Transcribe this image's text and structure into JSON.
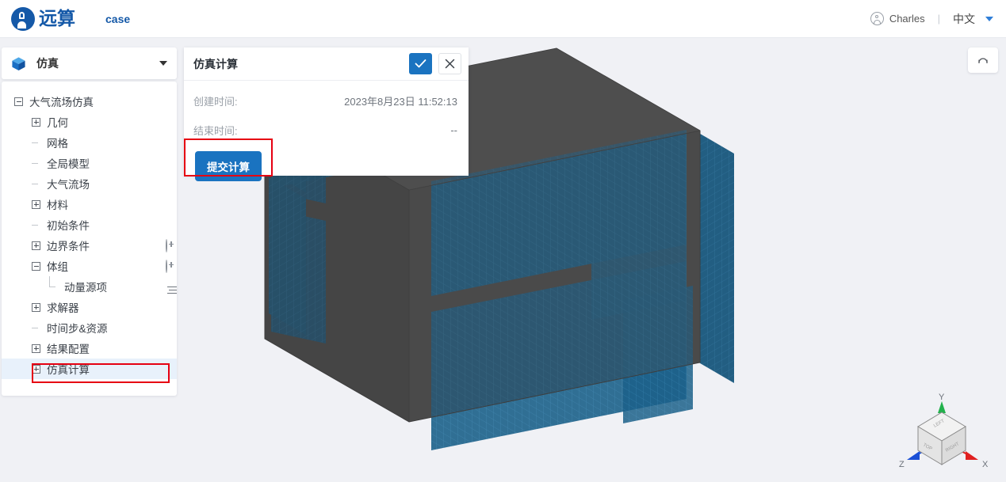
{
  "header": {
    "brand_name": "远算",
    "brand_logo_icon": "yuansuan-logo-icon",
    "case_label": "case",
    "user_name": "Charles",
    "user_icon": "user-avatar-icon",
    "divider": "|",
    "language": "中文",
    "language_caret_icon": "chevron-down-icon"
  },
  "sidebar": {
    "header": {
      "icon": "blue-cube-icon",
      "title": "仿真",
      "caret_icon": "chevron-down-icon"
    },
    "tree": [
      {
        "label": "大气流场仿真",
        "indent": 0,
        "toggle": "minus",
        "action": "warning-icon",
        "selected": false
      },
      {
        "label": "几何",
        "indent": 1,
        "toggle": "plus",
        "action": "",
        "selected": false
      },
      {
        "label": "网格",
        "indent": 1,
        "toggle": "guide",
        "action": "",
        "selected": false
      },
      {
        "label": "全局模型",
        "indent": 1,
        "toggle": "guide",
        "action": "",
        "selected": false
      },
      {
        "label": "大气流场",
        "indent": 1,
        "toggle": "guide",
        "action": "",
        "selected": false
      },
      {
        "label": "材料",
        "indent": 1,
        "toggle": "plus",
        "action": "",
        "selected": false
      },
      {
        "label": "初始条件",
        "indent": 1,
        "toggle": "guide",
        "action": "",
        "selected": false
      },
      {
        "label": "边界条件",
        "indent": 1,
        "toggle": "plus",
        "action": "plus-circle",
        "selected": false
      },
      {
        "label": "体组",
        "indent": 1,
        "toggle": "minus",
        "action": "plus-circle",
        "selected": false
      },
      {
        "label": "动量源项",
        "sub_num": "1",
        "indent": 2,
        "toggle": "elbow",
        "action": "menu-icon",
        "selected": false
      },
      {
        "label": "求解器",
        "indent": 1,
        "toggle": "plus",
        "action": "",
        "selected": false
      },
      {
        "label": "时间步&资源",
        "indent": 1,
        "toggle": "guide",
        "action": "",
        "selected": false
      },
      {
        "label": "结果配置",
        "indent": 1,
        "toggle": "plus",
        "action": "",
        "selected": false
      },
      {
        "label": "仿真计算",
        "indent": 1,
        "toggle": "plus",
        "action": "",
        "selected": true
      }
    ]
  },
  "detail_panel": {
    "title": "仿真计算",
    "confirm_icon": "check-icon",
    "cancel_icon": "close-icon",
    "rows": [
      {
        "key": "创建时间:",
        "value": "2023年8月23日 11:52:13"
      },
      {
        "key": "结束时间:",
        "value": "--"
      }
    ],
    "submit_label": "提交计算"
  },
  "viewport": {
    "reset_view_icon": "reset-view-icon",
    "axis_cube": {
      "x_label": "X",
      "y_label": "Y",
      "z_label": "Z",
      "face_top": "TOP",
      "face_left": "LEFT",
      "face_right": "RIGHT",
      "x_color": "#e02020",
      "y_color": "#22b14c",
      "z_color": "#1a4fd6"
    },
    "model": {
      "shell_color": "#4a4a4a",
      "mesh_color": "#1b6089",
      "background": "#f0f1f5"
    }
  },
  "annotations": {
    "highlight_color": "#e60012",
    "boxes": [
      "submit-button-highlight",
      "sidebar-item-highlight"
    ]
  }
}
